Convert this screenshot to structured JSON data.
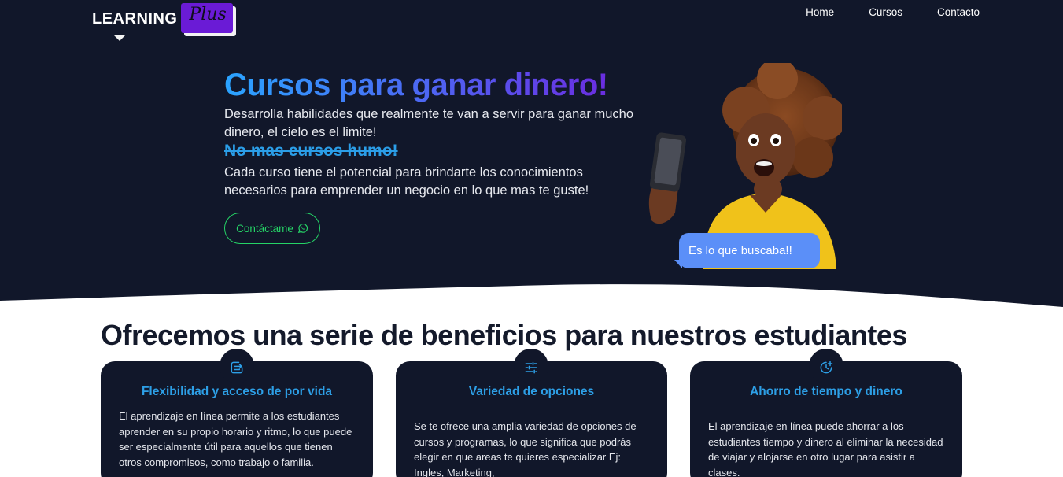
{
  "brand": {
    "name": "LEARNING",
    "badge": "Plus"
  },
  "nav": {
    "items": [
      "Home",
      "Cursos",
      "Contacto"
    ]
  },
  "hero": {
    "title": "Cursos para ganar dinero!",
    "paragraph1": "Desarrolla habilidades que realmente te van a servir para ganar mucho dinero, el cielo es el limite!",
    "strike": "No mas cursos humo!",
    "paragraph2": "Cada curso tiene el potencial para brindarte los conocimientos necesarios para emprender un negocio en lo que mas te guste!",
    "cta_label": "Contáctame",
    "cta_icon": "whatsapp-icon",
    "bubble": "Es lo que buscaba!!"
  },
  "benefits": {
    "title": "Ofrecemos una serie de beneficios para nuestros estudiantes",
    "cards": [
      {
        "icon": "transfer-icon",
        "title": "Flexibilidad y acceso de por vida",
        "body": "El aprendizaje en línea permite a los estudiantes aprender en su propio horario y ritmo, lo que puede ser especialmente útil para aquellos que tienen otros compromisos, como trabajo o familia."
      },
      {
        "icon": "sliders-icon",
        "title": "Variedad de opciones",
        "body": "Se te ofrece una amplia variedad de opciones de cursos y programas, lo que significa que podrás elegir en que areas te quieres especializar Ej: Ingles, Marketing,"
      },
      {
        "icon": "clock-plus-icon",
        "title": "Ahorro de tiempo y dinero",
        "body": "El aprendizaje en línea puede ahorrar a los estudiantes tiempo y dinero al eliminar la necesidad de viajar y alojarse en otro lugar para asistir a clases."
      }
    ]
  },
  "colors": {
    "dark": "#11172a",
    "accent_blue": "#2d9fe6",
    "purple": "#6a1bd6",
    "whatsapp": "#25d366",
    "bubble": "#5b8ff8"
  }
}
